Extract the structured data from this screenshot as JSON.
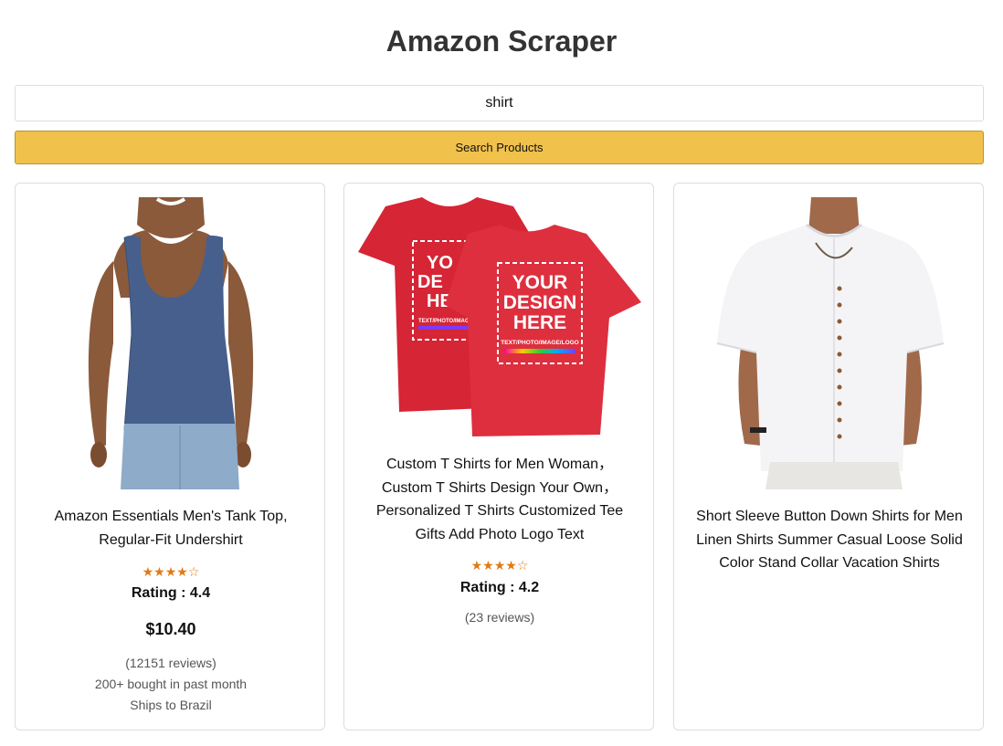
{
  "header": {
    "title": "Amazon Scraper"
  },
  "search": {
    "value": "shirt",
    "button_label": "Search Products"
  },
  "colors": {
    "button_bg": "#f0c14b",
    "star": "#e47911"
  },
  "products": [
    {
      "title": "Amazon Essentials Men's Tank Top, Regular-Fit Undershirt",
      "stars": "★★★★☆",
      "rating_label": "Rating : 4.4",
      "price": "$10.40",
      "reviews": "(12151 reviews)",
      "bought": "200+ bought in past month",
      "shipping": "Ships to Brazil"
    },
    {
      "title": "Custom T Shirts for Men Woman，Custom T Shirts Design Your Own，Personalized T Shirts Customized Tee Gifts Add Photo Logo Text",
      "stars": "★★★★☆",
      "rating_label": "Rating : 4.2",
      "reviews": "(23 reviews)",
      "image_text": {
        "big1": "YOUR",
        "big2": "DESIGN",
        "big3": "HERE",
        "small": "TEXT/PHOTO/IMAGE/LOGO",
        "back1": "YO",
        "back2": "DE",
        "back3": "HE",
        "back_small": "TEXT/PHOTO/IMAGE/L"
      }
    },
    {
      "title": "Short Sleeve Button Down Shirts for Men Linen Shirts Summer Casual Loose Solid Color Stand Collar Vacation Shirts"
    }
  ]
}
